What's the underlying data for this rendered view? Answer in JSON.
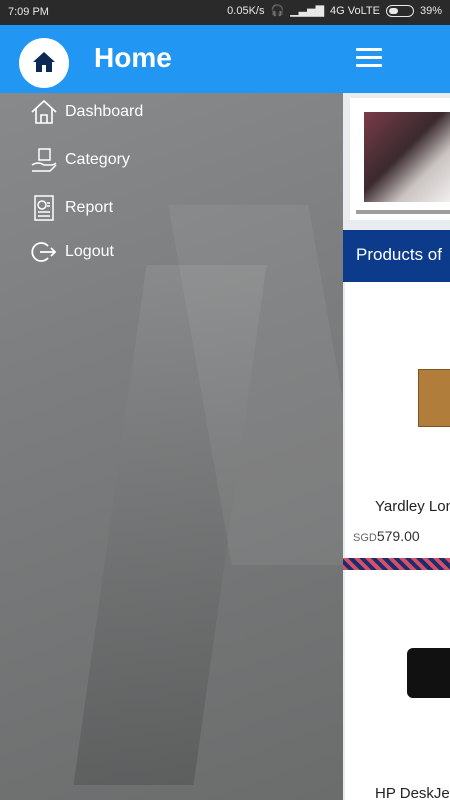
{
  "status_bar": {
    "time": "7:09 PM",
    "speed": "0.05K/s",
    "network": "4G VoLTE",
    "battery": "39%"
  },
  "drawer": {
    "title": "Home",
    "menu": [
      {
        "label": "Dashboard",
        "icon": "home-icon"
      },
      {
        "label": "Category",
        "icon": "category-icon"
      },
      {
        "label": "Report",
        "icon": "report-icon"
      },
      {
        "label": "Logout",
        "icon": "logout-icon"
      }
    ]
  },
  "content": {
    "section_title": "Products of",
    "products": [
      {
        "name": "Yardley Lon",
        "currency": "SGD",
        "price": "579.00"
      },
      {
        "name": "HP DeskJe"
      }
    ]
  },
  "colors": {
    "primary": "#2196f3",
    "section": "#0d3b8c"
  }
}
